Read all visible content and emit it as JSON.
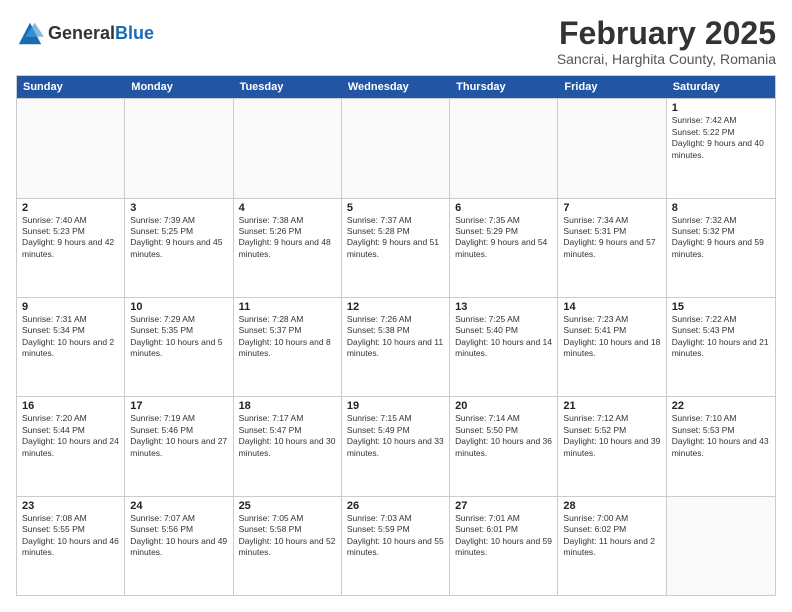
{
  "logo": {
    "general": "General",
    "blue": "Blue"
  },
  "title": "February 2025",
  "subtitle": "Sancrai, Harghita County, Romania",
  "header": {
    "days": [
      "Sunday",
      "Monday",
      "Tuesday",
      "Wednesday",
      "Thursday",
      "Friday",
      "Saturday"
    ]
  },
  "weeks": [
    {
      "cells": [
        {
          "day": "",
          "info": "",
          "empty": true
        },
        {
          "day": "",
          "info": "",
          "empty": true
        },
        {
          "day": "",
          "info": "",
          "empty": true
        },
        {
          "day": "",
          "info": "",
          "empty": true
        },
        {
          "day": "",
          "info": "",
          "empty": true
        },
        {
          "day": "",
          "info": "",
          "empty": true
        },
        {
          "day": "1",
          "info": "Sunrise: 7:42 AM\nSunset: 5:22 PM\nDaylight: 9 hours and 40 minutes.",
          "empty": false
        }
      ]
    },
    {
      "cells": [
        {
          "day": "2",
          "info": "Sunrise: 7:40 AM\nSunset: 5:23 PM\nDaylight: 9 hours and 42 minutes.",
          "empty": false
        },
        {
          "day": "3",
          "info": "Sunrise: 7:39 AM\nSunset: 5:25 PM\nDaylight: 9 hours and 45 minutes.",
          "empty": false
        },
        {
          "day": "4",
          "info": "Sunrise: 7:38 AM\nSunset: 5:26 PM\nDaylight: 9 hours and 48 minutes.",
          "empty": false
        },
        {
          "day": "5",
          "info": "Sunrise: 7:37 AM\nSunset: 5:28 PM\nDaylight: 9 hours and 51 minutes.",
          "empty": false
        },
        {
          "day": "6",
          "info": "Sunrise: 7:35 AM\nSunset: 5:29 PM\nDaylight: 9 hours and 54 minutes.",
          "empty": false
        },
        {
          "day": "7",
          "info": "Sunrise: 7:34 AM\nSunset: 5:31 PM\nDaylight: 9 hours and 57 minutes.",
          "empty": false
        },
        {
          "day": "8",
          "info": "Sunrise: 7:32 AM\nSunset: 5:32 PM\nDaylight: 9 hours and 59 minutes.",
          "empty": false
        }
      ]
    },
    {
      "cells": [
        {
          "day": "9",
          "info": "Sunrise: 7:31 AM\nSunset: 5:34 PM\nDaylight: 10 hours and 2 minutes.",
          "empty": false
        },
        {
          "day": "10",
          "info": "Sunrise: 7:29 AM\nSunset: 5:35 PM\nDaylight: 10 hours and 5 minutes.",
          "empty": false
        },
        {
          "day": "11",
          "info": "Sunrise: 7:28 AM\nSunset: 5:37 PM\nDaylight: 10 hours and 8 minutes.",
          "empty": false
        },
        {
          "day": "12",
          "info": "Sunrise: 7:26 AM\nSunset: 5:38 PM\nDaylight: 10 hours and 11 minutes.",
          "empty": false
        },
        {
          "day": "13",
          "info": "Sunrise: 7:25 AM\nSunset: 5:40 PM\nDaylight: 10 hours and 14 minutes.",
          "empty": false
        },
        {
          "day": "14",
          "info": "Sunrise: 7:23 AM\nSunset: 5:41 PM\nDaylight: 10 hours and 18 minutes.",
          "empty": false
        },
        {
          "day": "15",
          "info": "Sunrise: 7:22 AM\nSunset: 5:43 PM\nDaylight: 10 hours and 21 minutes.",
          "empty": false
        }
      ]
    },
    {
      "cells": [
        {
          "day": "16",
          "info": "Sunrise: 7:20 AM\nSunset: 5:44 PM\nDaylight: 10 hours and 24 minutes.",
          "empty": false
        },
        {
          "day": "17",
          "info": "Sunrise: 7:19 AM\nSunset: 5:46 PM\nDaylight: 10 hours and 27 minutes.",
          "empty": false
        },
        {
          "day": "18",
          "info": "Sunrise: 7:17 AM\nSunset: 5:47 PM\nDaylight: 10 hours and 30 minutes.",
          "empty": false
        },
        {
          "day": "19",
          "info": "Sunrise: 7:15 AM\nSunset: 5:49 PM\nDaylight: 10 hours and 33 minutes.",
          "empty": false
        },
        {
          "day": "20",
          "info": "Sunrise: 7:14 AM\nSunset: 5:50 PM\nDaylight: 10 hours and 36 minutes.",
          "empty": false
        },
        {
          "day": "21",
          "info": "Sunrise: 7:12 AM\nSunset: 5:52 PM\nDaylight: 10 hours and 39 minutes.",
          "empty": false
        },
        {
          "day": "22",
          "info": "Sunrise: 7:10 AM\nSunset: 5:53 PM\nDaylight: 10 hours and 43 minutes.",
          "empty": false
        }
      ]
    },
    {
      "cells": [
        {
          "day": "23",
          "info": "Sunrise: 7:08 AM\nSunset: 5:55 PM\nDaylight: 10 hours and 46 minutes.",
          "empty": false
        },
        {
          "day": "24",
          "info": "Sunrise: 7:07 AM\nSunset: 5:56 PM\nDaylight: 10 hours and 49 minutes.",
          "empty": false
        },
        {
          "day": "25",
          "info": "Sunrise: 7:05 AM\nSunset: 5:58 PM\nDaylight: 10 hours and 52 minutes.",
          "empty": false
        },
        {
          "day": "26",
          "info": "Sunrise: 7:03 AM\nSunset: 5:59 PM\nDaylight: 10 hours and 55 minutes.",
          "empty": false
        },
        {
          "day": "27",
          "info": "Sunrise: 7:01 AM\nSunset: 6:01 PM\nDaylight: 10 hours and 59 minutes.",
          "empty": false
        },
        {
          "day": "28",
          "info": "Sunrise: 7:00 AM\nSunset: 6:02 PM\nDaylight: 11 hours and 2 minutes.",
          "empty": false
        },
        {
          "day": "",
          "info": "",
          "empty": true
        }
      ]
    }
  ]
}
